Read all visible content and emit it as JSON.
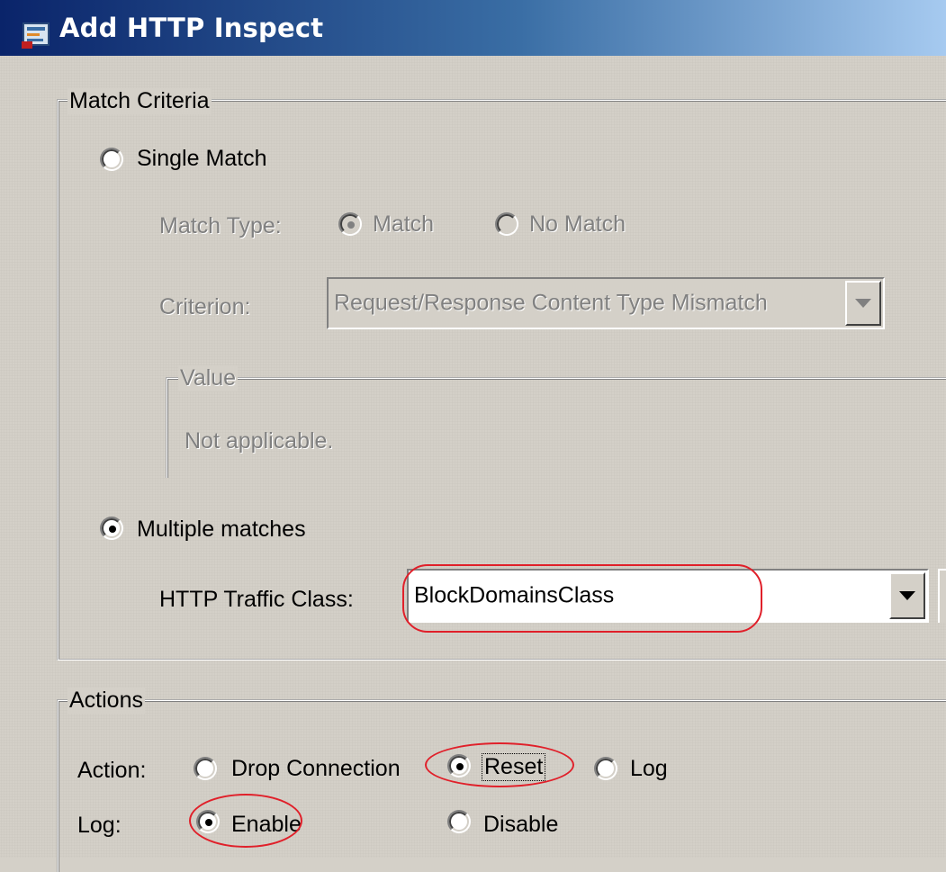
{
  "window": {
    "title": "Add HTTP Inspect",
    "icon": "app-icon"
  },
  "match_criteria": {
    "legend": "Match Criteria",
    "single_match": {
      "label": "Single Match",
      "selected": false
    },
    "match_type": {
      "label": "Match Type:",
      "options": [
        {
          "label": "Match",
          "selected": true
        },
        {
          "label": "No Match",
          "selected": false
        }
      ]
    },
    "criterion": {
      "label": "Criterion:",
      "value": "Request/Response Content Type Mismatch"
    },
    "value_group": {
      "legend": "Value",
      "text": "Not applicable."
    },
    "multiple_matches": {
      "label": "Multiple matches",
      "selected": true
    },
    "http_traffic_class": {
      "label": "HTTP Traffic Class:",
      "value": "BlockDomainsClass"
    }
  },
  "actions": {
    "legend": "Actions",
    "action": {
      "label": "Action:",
      "options": [
        {
          "label": "Drop Connection",
          "selected": false
        },
        {
          "label": "Reset",
          "selected": true
        },
        {
          "label": "Log",
          "selected": false
        }
      ]
    },
    "log": {
      "label": "Log:",
      "options": [
        {
          "label": "Enable",
          "selected": true
        },
        {
          "label": "Disable",
          "selected": false
        }
      ]
    }
  },
  "colors": {
    "highlight_annotation": "#e0202a",
    "title_bar": "#0a246a",
    "dialog_bg": "#d4d0c8"
  }
}
